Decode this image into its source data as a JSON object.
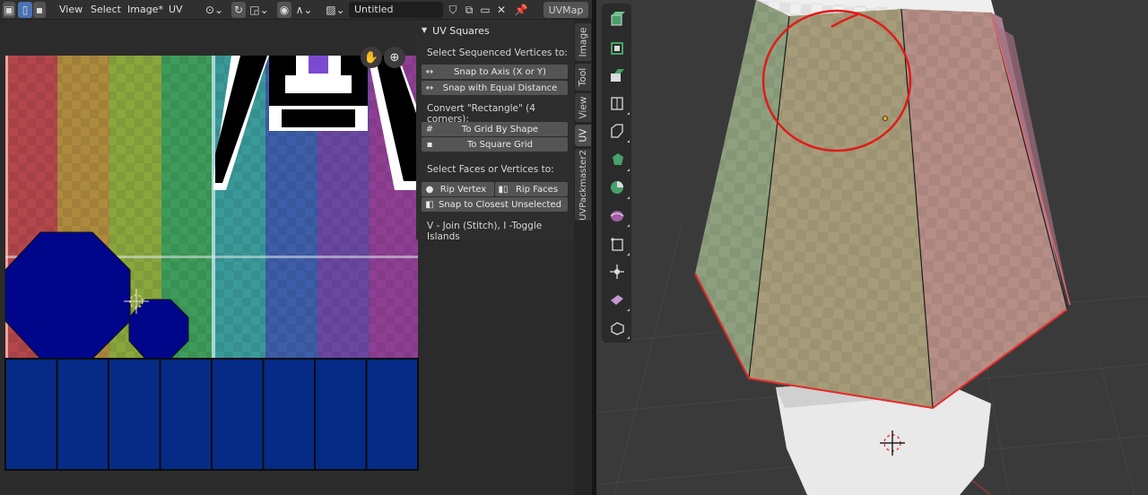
{
  "uv_editor": {
    "header": {
      "menus": [
        "View",
        "Select",
        "Image*",
        "UV"
      ],
      "image_name": "Untitled",
      "uv_map": "UVMap"
    }
  },
  "uv_squares_panel": {
    "title": "UV Squares",
    "section1_label": "Select Sequenced Vertices to:",
    "snap_axis": "Snap to Axis (X or Y)",
    "snap_equal": "Snap with Equal Distance",
    "section2_label": "Convert \"Rectangle\" (4 corners):",
    "grid_by_shape": "To Grid By Shape",
    "square_grid": "To Square Grid",
    "section3_label": "Select Faces or Vertices to:",
    "rip_vertex": "Rip Vertex",
    "rip_faces": "Rip Faces",
    "snap_closest": "Snap to Closest Unselected",
    "hint": "V - Join (Stitch), I -Toggle Islands"
  },
  "sidebar_tabs": [
    "Image",
    "Tool",
    "View",
    "UV",
    "UVPackmaster2"
  ],
  "active_tab": "UV",
  "colors": {
    "selected_face": "#0a2a8a",
    "selected_edge": "#e53a3a",
    "annotation": "#e01b1b",
    "accent": "#48a06a"
  }
}
